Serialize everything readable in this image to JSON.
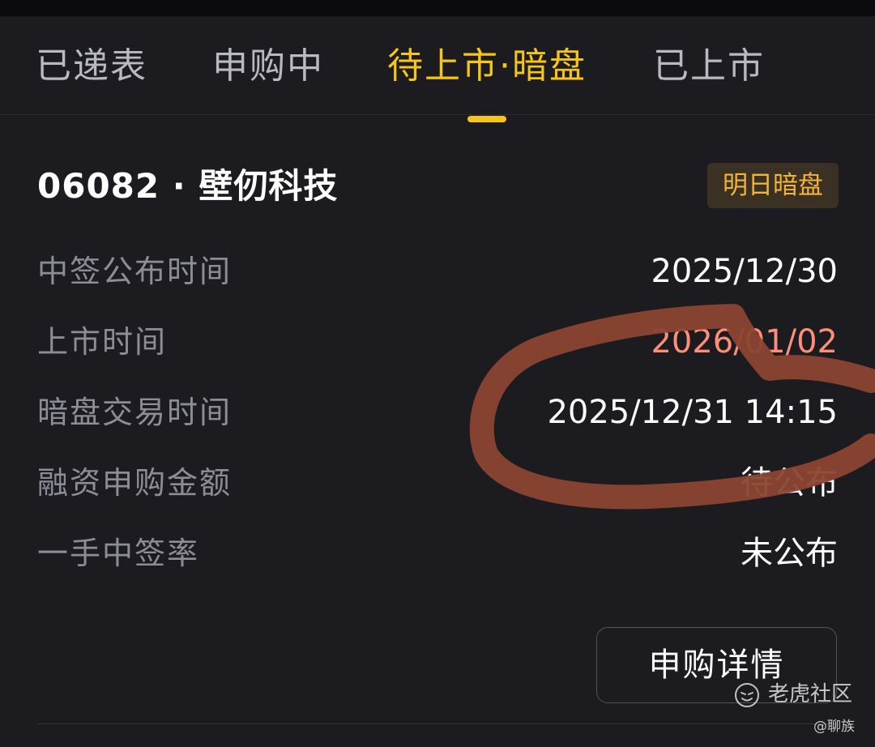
{
  "tabs": [
    {
      "label": "已递表",
      "active": false
    },
    {
      "label": "申购中",
      "active": false
    },
    {
      "label": "待上市·暗盘",
      "active": true
    },
    {
      "label": "已上市",
      "active": false
    }
  ],
  "stock": {
    "code": "06082",
    "separator": "·",
    "name": "壁仞科技",
    "title": "06082 · 壁仞科技",
    "badge": "明日暗盘"
  },
  "details": [
    {
      "label": "中签公布时间",
      "value": "2025/12/30"
    },
    {
      "label": "上市时间",
      "value": "2026/01/02"
    },
    {
      "label": "暗盘交易时间",
      "value": "2025/12/31 14:15"
    },
    {
      "label": "融资申购金额",
      "value": "待公布"
    },
    {
      "label": "一手中签率",
      "value": "未公布"
    }
  ],
  "actions": {
    "detail_button": "申购详情"
  },
  "watermark": {
    "brand": "老虎社区",
    "user": "@聊族"
  },
  "colors": {
    "background": "#1b1b20",
    "active_tab": "#f5c518",
    "badge_text": "#f2b33d",
    "badge_bg": "#3a3122",
    "listing_date": "#ff8e78",
    "scribble": "#8b4532"
  },
  "icons": {
    "watermark_logo": "tiger-logo-icon"
  }
}
